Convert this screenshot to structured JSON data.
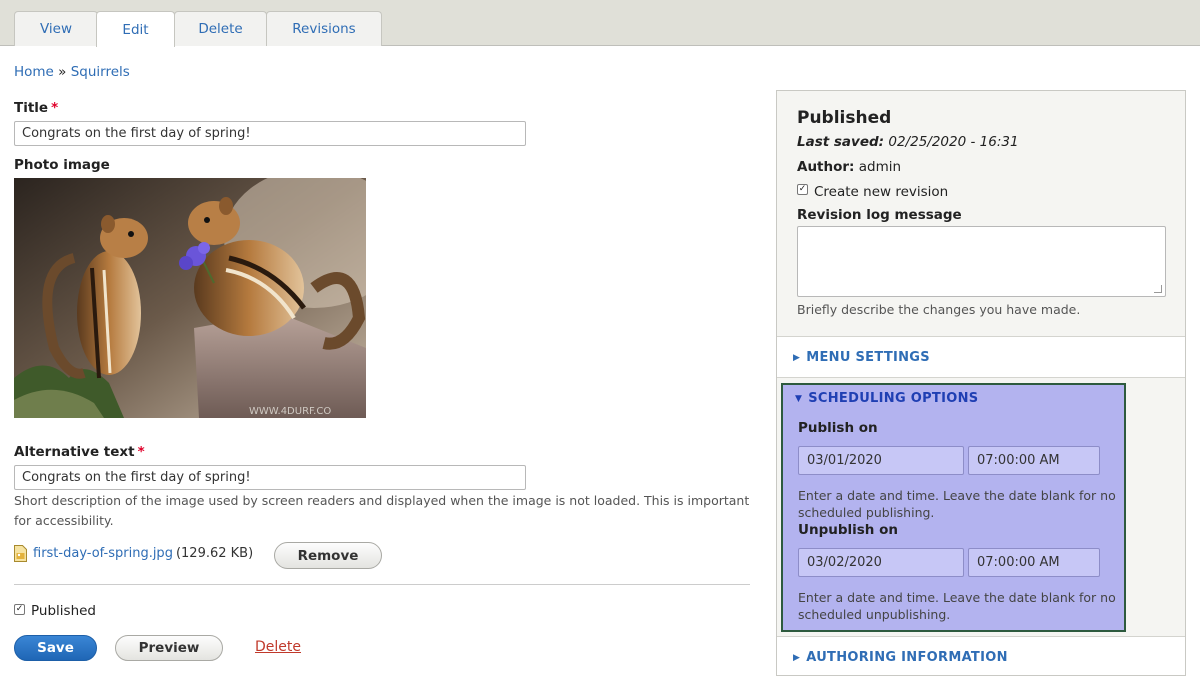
{
  "tabs": [
    {
      "label": "View"
    },
    {
      "label": "Edit"
    },
    {
      "label": "Delete"
    },
    {
      "label": "Revisions"
    }
  ],
  "breadcrumb": {
    "home": "Home",
    "separator": "»",
    "current": "Squirrels"
  },
  "form": {
    "title_label": "Title",
    "required_mark": "*",
    "title_value": "Congrats on the first day of spring!",
    "photo_label": "Photo image",
    "photo_watermark": "WWW.4DURF.CO",
    "alt_label": "Alternative text",
    "alt_value": "Congrats on the first day of spring!",
    "alt_help": "Short description of the image used by screen readers and displayed when the image is not loaded. This is important for accessibility.",
    "file_name": "first-day-of-spring.jpg",
    "file_size": "(129.62 KB)",
    "remove_label": "Remove",
    "published_label": "Published",
    "save_label": "Save",
    "preview_label": "Preview",
    "delete_label": "Delete"
  },
  "sidebar": {
    "status": "Published",
    "last_saved_label": "Last saved:",
    "last_saved_value": "02/25/2020 - 16:31",
    "author_label": "Author:",
    "author_value": "admin",
    "new_revision_label": "Create new revision",
    "revision_log_label": "Revision log message",
    "revision_help": "Briefly describe the changes you have made.",
    "menu_settings": "MENU SETTINGS",
    "scheduling": {
      "title": "SCHEDULING OPTIONS",
      "publish_label": "Publish on",
      "publish_date": "03/01/2020",
      "publish_time": "07:00:00 AM",
      "publish_help": "Enter a date and time. Leave the date blank for no scheduled publishing.",
      "unpublish_label": "Unpublish on",
      "unpublish_date": "03/02/2020",
      "unpublish_time": "07:00:00 AM",
      "unpublish_help": "Enter a date and time. Leave the date blank for no scheduled unpublishing."
    },
    "authoring_info": "AUTHORING INFORMATION"
  },
  "colors": {
    "link": "#2f6db5",
    "primary_button": "#1f66b5",
    "highlight": "#b3b3ef",
    "highlight_border": "#2d5a3e",
    "required": "#e0002a",
    "delete_link": "#c0392b"
  }
}
